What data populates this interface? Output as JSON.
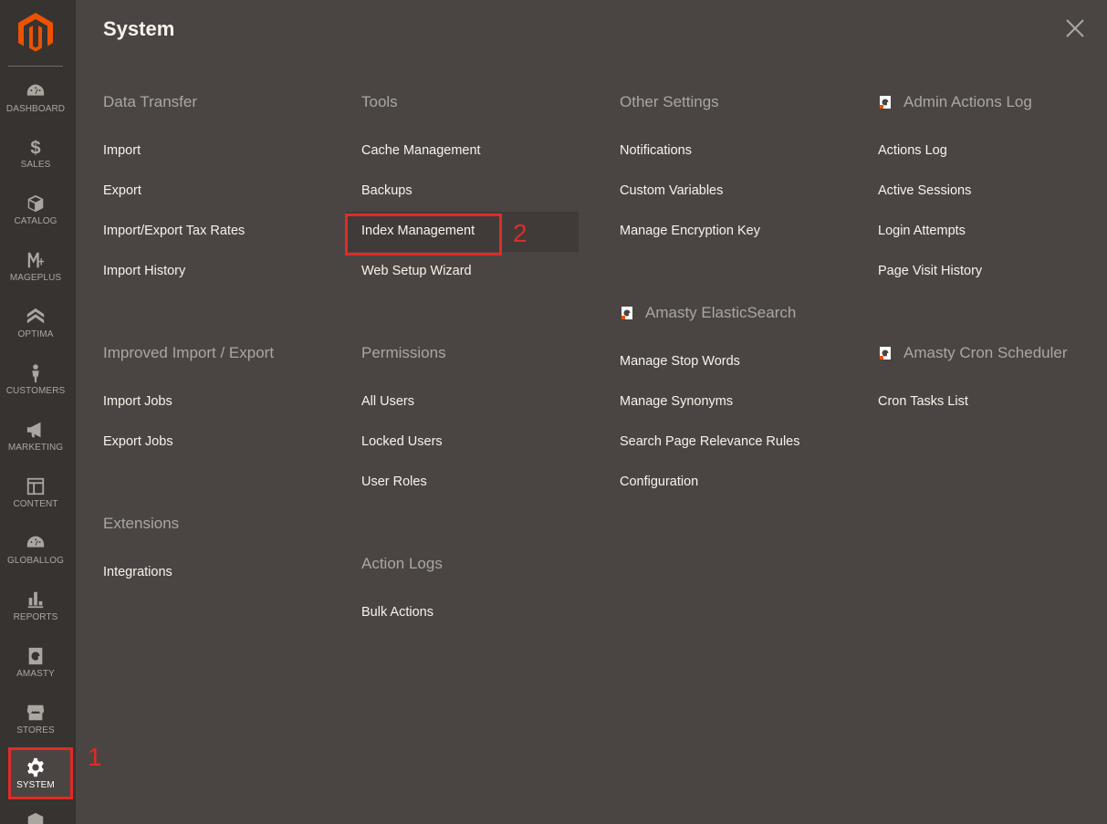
{
  "sidebar": {
    "items": [
      {
        "label": "DASHBOARD",
        "icon": "dashboard-icon"
      },
      {
        "label": "SALES",
        "icon": "dollar-icon"
      },
      {
        "label": "CATALOG",
        "icon": "box-icon"
      },
      {
        "label": "MAGEPLUS",
        "icon": "mageplus-icon"
      },
      {
        "label": "OPTIMA",
        "icon": "optima-icon"
      },
      {
        "label": "CUSTOMERS",
        "icon": "person-icon"
      },
      {
        "label": "MARKETING",
        "icon": "megaphone-icon"
      },
      {
        "label": "CONTENT",
        "icon": "layout-icon"
      },
      {
        "label": "GLOBALLOG",
        "icon": "gauge-icon"
      },
      {
        "label": "REPORTS",
        "icon": "bar-chart-icon"
      },
      {
        "label": "AMASTY",
        "icon": "amasty-icon"
      },
      {
        "label": "STORES",
        "icon": "store-icon"
      },
      {
        "label": "SYSTEM",
        "icon": "gear-icon"
      }
    ],
    "active": "SYSTEM"
  },
  "panel": {
    "title": "System",
    "close_icon": "close-icon"
  },
  "columns": {
    "col1": {
      "data_transfer": {
        "title": "Data Transfer",
        "links": [
          "Import",
          "Export",
          "Import/Export Tax Rates",
          "Import History"
        ]
      },
      "improved_import_export": {
        "title": "Improved Import / Export",
        "links": [
          "Import Jobs",
          "Export Jobs"
        ]
      },
      "extensions": {
        "title": "Extensions",
        "links": [
          "Integrations"
        ]
      }
    },
    "col2": {
      "tools": {
        "title": "Tools",
        "links": [
          "Cache Management",
          "Backups",
          "Index Management",
          "Web Setup Wizard"
        ]
      },
      "permissions": {
        "title": "Permissions",
        "links": [
          "All Users",
          "Locked Users",
          "User Roles"
        ]
      },
      "action_logs": {
        "title": "Action Logs",
        "links": [
          "Bulk Actions"
        ]
      }
    },
    "col3": {
      "other_settings": {
        "title": "Other Settings",
        "links": [
          "Notifications",
          "Custom Variables",
          "Manage Encryption Key"
        ]
      },
      "amasty_elasticsearch": {
        "title": "Amasty ElasticSearch",
        "links": [
          "Manage Stop Words",
          "Manage Synonyms",
          "Search Page Relevance Rules",
          "Configuration"
        ]
      }
    },
    "col4": {
      "admin_actions_log": {
        "title": "Admin Actions Log",
        "links": [
          "Actions Log",
          "Active Sessions",
          "Login Attempts",
          "Page Visit History"
        ]
      },
      "amasty_cron_scheduler": {
        "title": "Amasty Cron Scheduler",
        "links": [
          "Cron Tasks List"
        ]
      }
    }
  },
  "annotations": {
    "callout_1": "1",
    "callout_2": "2",
    "color": "#e02b27"
  },
  "colors": {
    "accent": "#eb5202",
    "highlight": "#e02b27"
  }
}
